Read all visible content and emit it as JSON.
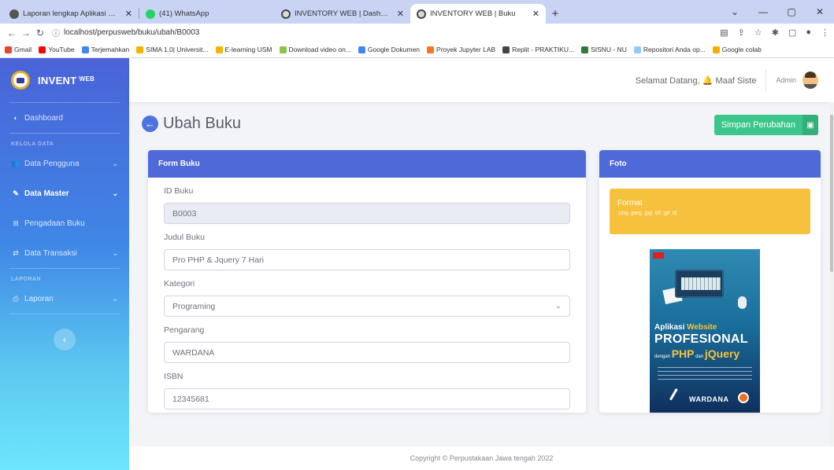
{
  "browser": {
    "tabs": [
      {
        "title": "Laporan lengkap Aplikasi Sistem",
        "active": false
      },
      {
        "title": "(41) WhatsApp",
        "active": false
      },
      {
        "title": "INVENTORY WEB | Dashboard",
        "active": false
      },
      {
        "title": "INVENTORY WEB | Buku",
        "active": true
      }
    ],
    "url": "localhost/perpusweb/buku/ubah/B0003",
    "bookmarks": [
      "Gmail",
      "YouTube",
      "Terjemahkan",
      "SIMA 1.0| Universit...",
      "E-learning USM",
      "Download video on...",
      "Google Dokumen",
      "Proyek Jupyter LAB",
      "Replit - PRAKTIKU...",
      "SISNU - NU",
      "Repositori Anda op...",
      "Google colab"
    ]
  },
  "sidebar": {
    "brand": "INVENT",
    "brand_sup": "WEB",
    "items": [
      {
        "label": "Dashboard",
        "icon": "dashboard-icon"
      },
      {
        "label": "Data Pengguna",
        "icon": "users-icon"
      },
      {
        "label": "Data Master",
        "icon": "edit-icon"
      },
      {
        "label": "Pengadaan Buku",
        "icon": "cart-icon"
      },
      {
        "label": "Data Transaksi",
        "icon": "exchange-icon"
      },
      {
        "label": "Laporan",
        "icon": "print-icon"
      }
    ],
    "headings": [
      "KELOLA DATA",
      "LAPORAN"
    ]
  },
  "topbar": {
    "greeting": "Selamat Datang, 🔔 Maaf Siste",
    "user": "Admin"
  },
  "page": {
    "title": "Ubah Buku",
    "save_label": "Simpan Perubahan"
  },
  "form": {
    "header": "Form Buku",
    "fields": [
      {
        "label": "ID Buku",
        "value": "B0003"
      },
      {
        "label": "Judul Buku",
        "value": "Pro PHP & Jquery 7 Hari"
      },
      {
        "label": "Kategori",
        "value": "Programing"
      },
      {
        "label": "Pengarang",
        "value": "WARDANA"
      },
      {
        "label": "ISBN",
        "value": "12345681"
      }
    ]
  },
  "photo": {
    "header": "Foto",
    "format_title": "Format",
    "format_types": ".png .jpeg .jpg .tiff .gif .tif",
    "cover": {
      "line1a": "Aplikasi ",
      "line1b": "Website",
      "line2": "PROFESIONAL",
      "line3a": "dengan ",
      "line3b": "PHP",
      "line3c": " dan ",
      "line3d": "jQuery",
      "author": "WARDANA"
    }
  },
  "footer": "Copyright © Perpustakaan Jawa tengah 2022"
}
